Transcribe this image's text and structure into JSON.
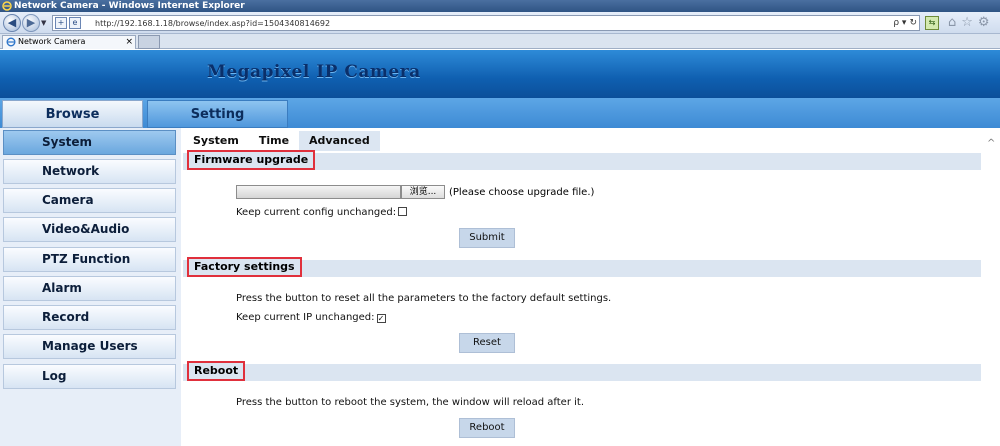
{
  "window": {
    "title": "Network Camera - Windows Internet Explorer",
    "url": "http://192.168.1.18/browse/index.asp?id=1504340814692",
    "tab_label": "Network Camera",
    "tab_close": "×",
    "search_glyph": "ρ ▾",
    "refresh_glyph": "↻",
    "compat_glyph": "⇆",
    "home_glyph": "⌂",
    "favorites_glyph": "☆",
    "tools_glyph": "⚙"
  },
  "banner": {
    "title": "Megapixel IP Camera"
  },
  "main_tabs": [
    {
      "label": "Browse"
    },
    {
      "label": "Setting"
    }
  ],
  "sidebar": {
    "items": [
      {
        "label": "System"
      },
      {
        "label": "Network"
      },
      {
        "label": "Camera"
      },
      {
        "label": "Video&Audio"
      },
      {
        "label": "PTZ Function"
      },
      {
        "label": "Alarm"
      },
      {
        "label": "Record"
      },
      {
        "label": "Manage Users"
      },
      {
        "label": "Log"
      }
    ]
  },
  "subtabs": [
    {
      "label": "System"
    },
    {
      "label": "Time"
    },
    {
      "label": "Advanced"
    }
  ],
  "firmware": {
    "title": "Firmware upgrade",
    "browse_label": "浏览...",
    "hint": "(Please choose upgrade file.)",
    "keep_config_label": "Keep current config unchanged:",
    "keep_config_checked": "",
    "submit_label": "Submit"
  },
  "factory": {
    "title": "Factory settings",
    "description": "Press the button to reset all the parameters to the factory default settings.",
    "keep_ip_label": "Keep current IP unchanged:",
    "keep_ip_checked": "✓",
    "reset_label": "Reset"
  },
  "reboot": {
    "title": "Reboot",
    "description": "Press the button to reboot the system, the window will reload after it.",
    "reboot_label": "Reboot"
  }
}
